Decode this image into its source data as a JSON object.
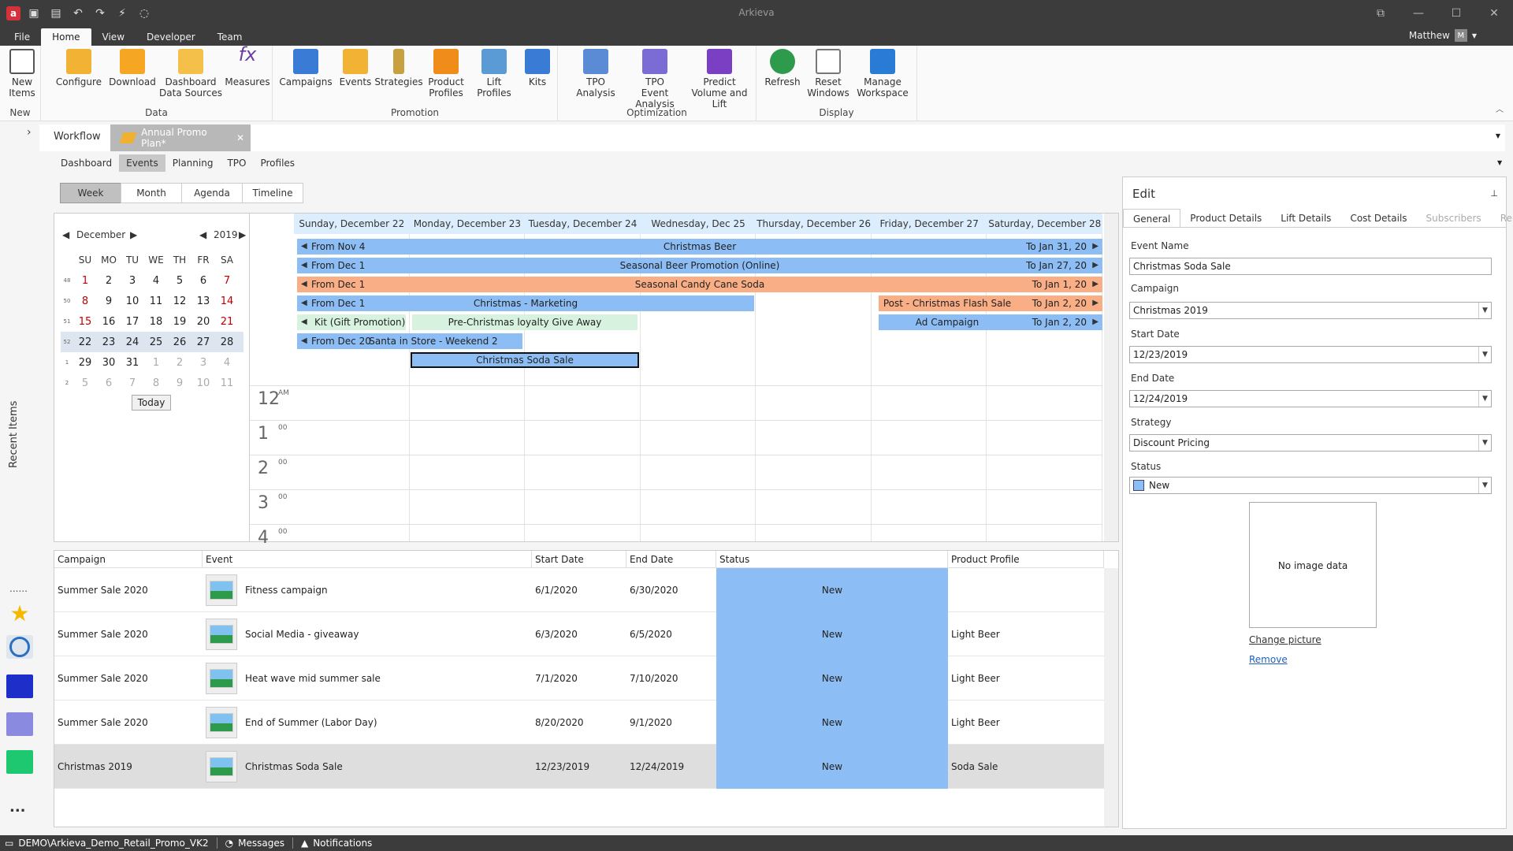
{
  "window": {
    "title": "Arkieva"
  },
  "menu": {
    "items": [
      "File",
      "Home",
      "View",
      "Developer",
      "Team"
    ],
    "user": "Matthew",
    "user_initial": "M"
  },
  "ribbon": {
    "new": {
      "btn": "New Items",
      "group": "New"
    },
    "data": {
      "group": "Data",
      "btns": [
        "Configure",
        "Download",
        "Dashboard Data Sources",
        "Measures"
      ]
    },
    "promotion": {
      "group": "Promotion",
      "btns": [
        "Campaigns",
        "Events",
        "Strategies",
        "Product Profiles",
        "Lift Profiles",
        "Kits"
      ]
    },
    "optimization": {
      "group": "Optimization",
      "btns": [
        "TPO Analysis",
        "TPO Event Analysis",
        "Predict Volume and Lift"
      ]
    },
    "display": {
      "group": "Display",
      "btns": [
        "Refresh",
        "Reset Windows",
        "Manage Workspace"
      ]
    }
  },
  "doc": {
    "workflow": "Workflow",
    "active_tab": "Annual Promo Plan*"
  },
  "subtabs": [
    "Dashboard",
    "Events",
    "Planning",
    "TPO",
    "Profiles"
  ],
  "views": [
    "Week",
    "Month",
    "Agenda",
    "Timeline"
  ],
  "left_rail": {
    "recent": "Recent Items",
    "dots": "......",
    "more": "..."
  },
  "minical": {
    "month": "December",
    "year": "2019",
    "dow": [
      "SU",
      "MO",
      "TU",
      "WE",
      "TH",
      "FR",
      "SA"
    ],
    "weeks": [
      {
        "wk": "48",
        "days": [
          "1",
          "2",
          "3",
          "4",
          "5",
          "6",
          "7"
        ]
      },
      {
        "wk": "50",
        "days": [
          "8",
          "9",
          "10",
          "11",
          "12",
          "13",
          "14"
        ]
      },
      {
        "wk": "51",
        "days": [
          "15",
          "16",
          "17",
          "18",
          "19",
          "20",
          "21"
        ]
      },
      {
        "wk": "52",
        "days": [
          "22",
          "23",
          "24",
          "25",
          "26",
          "27",
          "28"
        ]
      },
      {
        "wk": "1",
        "days": [
          "29",
          "30",
          "31",
          "1",
          "2",
          "3",
          "4"
        ]
      },
      {
        "wk": "2",
        "days": [
          "5",
          "6",
          "7",
          "8",
          "9",
          "10",
          "11"
        ]
      }
    ],
    "today": "Today"
  },
  "calendar": {
    "days": [
      "Sunday, December 22",
      "Monday, December 23",
      "Tuesday, December 24",
      "Wednesday, Dec 25",
      "Thursday, December 26",
      "Friday, December 27",
      "Saturday, December 28"
    ],
    "events": {
      "e1": {
        "from": "From Nov 4",
        "name": "Christmas Beer",
        "to": "To Jan 31, 20"
      },
      "e2": {
        "from": "From Dec 1",
        "name": "Seasonal Beer Promotion (Online)",
        "to": "To Jan 27, 20"
      },
      "e3": {
        "from": "From Dec 1",
        "name": "Seasonal Candy Cane Soda",
        "to": "To Jan 1, 20"
      },
      "e4": {
        "from": "From Dec 1",
        "name": "Christmas - Marketing"
      },
      "e5": {
        "name": "Post - Christmas Flash Sale",
        "to": "To Jan 2, 20"
      },
      "e6": {
        "name": "Kit (Gift Promotion)"
      },
      "e7": {
        "name": "Pre-Christmas loyalty Give Away"
      },
      "e8": {
        "name": "Ad Campaign",
        "to": "To Jan 2, 20"
      },
      "e9": {
        "from": "From Dec 20",
        "name": "Santa in Store - Weekend 2"
      },
      "e10": {
        "name": "Christmas Soda Sale"
      }
    },
    "hours": [
      {
        "h": "12",
        "m": "AM"
      },
      {
        "h": "1",
        "m": "00"
      },
      {
        "h": "2",
        "m": "00"
      },
      {
        "h": "3",
        "m": "00"
      },
      {
        "h": "4",
        "m": "00"
      }
    ]
  },
  "grid": {
    "columns": [
      "Campaign",
      "Event",
      "Start Date",
      "End Date",
      "Status",
      "Product Profile"
    ],
    "rows": [
      {
        "campaign": "Summer Sale 2020",
        "event": "Fitness campaign",
        "start": "6/1/2020",
        "end": "6/30/2020",
        "status": "New",
        "profile": ""
      },
      {
        "campaign": "Summer Sale 2020",
        "event": "Social Media - giveaway",
        "start": "6/3/2020",
        "end": "6/5/2020",
        "status": "New",
        "profile": "Light Beer"
      },
      {
        "campaign": "Summer Sale 2020",
        "event": "Heat wave mid summer sale",
        "start": "7/1/2020",
        "end": "7/10/2020",
        "status": "New",
        "profile": "Light Beer"
      },
      {
        "campaign": "Summer Sale 2020",
        "event": "End of Summer (Labor Day)",
        "start": "8/20/2020",
        "end": "9/1/2020",
        "status": "New",
        "profile": "Light Beer"
      },
      {
        "campaign": "Christmas 2019",
        "event": "Christmas Soda Sale",
        "start": "12/23/2019",
        "end": "12/24/2019",
        "status": "New",
        "profile": "Soda Sale"
      }
    ]
  },
  "edit": {
    "title": "Edit",
    "tabs": [
      "General",
      "Product Details",
      "Lift Details",
      "Cost Details",
      "Subscribers",
      "Remi"
    ],
    "event_name_label": "Event Name",
    "event_name": "Christmas Soda Sale",
    "campaign_label": "Campaign",
    "campaign": "Christmas 2019",
    "start_label": "Start Date",
    "start": "12/23/2019",
    "end_label": "End Date",
    "end": "12/24/2019",
    "strategy_label": "Strategy",
    "strategy": "Discount Pricing",
    "status_label": "Status",
    "status": "New",
    "no_image": "No image data",
    "change_picture": "Change picture",
    "remove": "Remove"
  },
  "statusbar": {
    "db": "DEMO\\Arkieva_Demo_Retail_Promo_VK2",
    "messages": "Messages",
    "notifications": "Notifications"
  },
  "colors": {
    "event_blue": "#8cbdf5",
    "event_orange": "#f9ae85",
    "event_green": "#d7f2df",
    "dark_chrome": "#3c3c3c"
  }
}
